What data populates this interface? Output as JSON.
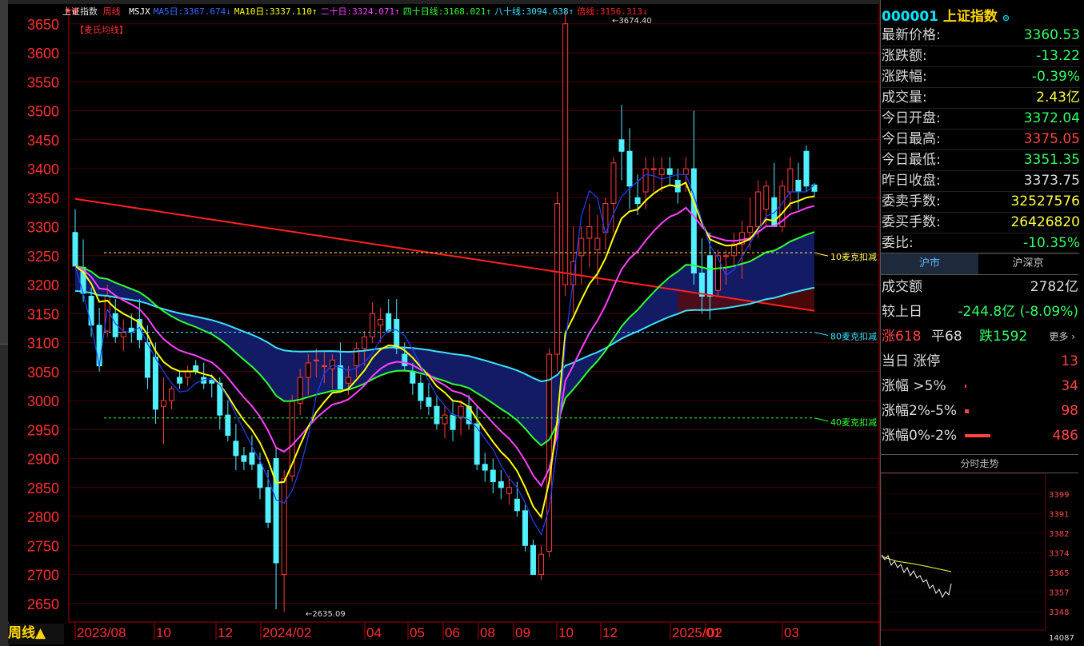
{
  "header": {
    "stock_name": "上证指数",
    "period": "周线",
    "ma_series": [
      {
        "label": "MSJX",
        "value": "",
        "color": "#ffffff"
      },
      {
        "label": "MA5日:",
        "value": "3367.674",
        "arrow": "↓",
        "color": "#3a6bff"
      },
      {
        "label": "MA10日:",
        "value": "3337.110",
        "arrow": "↑",
        "color": "#ffff00"
      },
      {
        "label": "二十日:",
        "value": "3324.071",
        "arrow": "↑",
        "color": "#ff40ff"
      },
      {
        "label": "四十日线:",
        "value": "3168.021",
        "arrow": "↑",
        "color": "#30ff30"
      },
      {
        "label": "八十线:",
        "value": "3094.638",
        "arrow": "↑",
        "color": "#40e0ff"
      },
      {
        "label": "倍线:",
        "value": "3156.313",
        "arrow": "↓",
        "color": "#ff2020"
      }
    ],
    "indicator_label": "【麦氏均线】"
  },
  "chart_data": {
    "type": "candlestick",
    "y_ticks": [
      2650,
      2700,
      2750,
      2800,
      2850,
      2900,
      2950,
      3000,
      3050,
      3100,
      3150,
      3200,
      3250,
      3300,
      3350,
      3400,
      3450,
      3500,
      3550,
      3600,
      3650
    ],
    "ylim": [
      2618,
      3680
    ],
    "x_ticks": [
      "2023/08",
      "10",
      "12",
      "2024/02",
      "04",
      "05",
      "06",
      "08",
      "09",
      "10",
      "12",
      "2025/01",
      "02",
      "03"
    ],
    "high_label": "3674.40",
    "low_label": "2635.09",
    "candles": [
      [
        3290,
        3330,
        3230,
        3232
      ],
      [
        3230,
        3278,
        3170,
        3185
      ],
      [
        3180,
        3195,
        3110,
        3130
      ],
      [
        3130,
        3160,
        3050,
        3060
      ],
      [
        3120,
        3200,
        3110,
        3180
      ],
      [
        3150,
        3175,
        3100,
        3110
      ],
      [
        3110,
        3140,
        3085,
        3118
      ],
      [
        3125,
        3150,
        3100,
        3118
      ],
      [
        3140,
        3175,
        3090,
        3105
      ],
      [
        3100,
        3130,
        3020,
        3040
      ],
      [
        3075,
        3100,
        2960,
        2985
      ],
      [
        2990,
        3040,
        2925,
        3000
      ],
      [
        3000,
        3025,
        2985,
        3020
      ],
      [
        3040,
        3050,
        3020,
        3030
      ],
      [
        3040,
        3060,
        3025,
        3050
      ],
      [
        3060,
        3070,
        3045,
        3050
      ],
      [
        3040,
        3065,
        3020,
        3030
      ],
      [
        3035,
        3045,
        3005,
        3030
      ],
      [
        3030,
        3040,
        2950,
        2975
      ],
      [
        2975,
        3000,
        2930,
        2940
      ],
      [
        2930,
        2960,
        2880,
        2905
      ],
      [
        2905,
        2920,
        2880,
        2895
      ],
      [
        2910,
        2940,
        2880,
        2890
      ],
      [
        2890,
        2910,
        2830,
        2850
      ],
      [
        2850,
        2880,
        2780,
        2790
      ],
      [
        2900,
        2920,
        2640,
        2720
      ],
      [
        2700,
        2880,
        2635,
        2865
      ],
      [
        2870,
        3010,
        2860,
        3000
      ],
      [
        2995,
        3055,
        2975,
        3040
      ],
      [
        3040,
        3080,
        3010,
        3065
      ],
      [
        3070,
        3090,
        3040,
        3070
      ],
      [
        3060,
        3085,
        3030,
        3060
      ],
      [
        3055,
        3080,
        3020,
        3070
      ],
      [
        3060,
        3100,
        3030,
        3020
      ],
      [
        3030,
        3060,
        3010,
        3040
      ],
      [
        3060,
        3100,
        3040,
        3090
      ],
      [
        3090,
        3120,
        3060,
        3110
      ],
      [
        3110,
        3170,
        3100,
        3150
      ],
      [
        3130,
        3160,
        3100,
        3140
      ],
      [
        3150,
        3175,
        3140,
        3120
      ],
      [
        3140,
        3175,
        3080,
        3090
      ],
      [
        3080,
        3100,
        3050,
        3060
      ],
      [
        3050,
        3065,
        3010,
        3030
      ],
      [
        3030,
        3045,
        2985,
        3000
      ],
      [
        3005,
        3030,
        2975,
        2990
      ],
      [
        2990,
        3010,
        2950,
        2960
      ],
      [
        2960,
        2990,
        2935,
        2975
      ],
      [
        2975,
        3000,
        2930,
        2950
      ],
      [
        2970,
        3000,
        2940,
        2990
      ],
      [
        2990,
        3010,
        2950,
        2960
      ],
      [
        2960,
        2990,
        2880,
        2890
      ],
      [
        2890,
        2910,
        2860,
        2880
      ],
      [
        2880,
        2900,
        2840,
        2860
      ],
      [
        2860,
        2880,
        2830,
        2850
      ],
      [
        2840,
        2870,
        2820,
        2850
      ],
      [
        2830,
        2860,
        2800,
        2810
      ],
      [
        2810,
        2820,
        2740,
        2750
      ],
      [
        2750,
        2760,
        2700,
        2700
      ],
      [
        2700,
        2750,
        2690,
        2735
      ],
      [
        2740,
        3090,
        2730,
        3080
      ],
      [
        3080,
        3360,
        3050,
        3340
      ],
      [
        3200,
        3674,
        3180,
        3650
      ],
      [
        3200,
        3300,
        3150,
        3240
      ],
      [
        3250,
        3300,
        3200,
        3280
      ],
      [
        3280,
        3340,
        3230,
        3300
      ],
      [
        3260,
        3320,
        3200,
        3280
      ],
      [
        3290,
        3350,
        3260,
        3340
      ],
      [
        3340,
        3420,
        3290,
        3410
      ],
      [
        3450,
        3510,
        3380,
        3430
      ],
      [
        3430,
        3470,
        3330,
        3370
      ],
      [
        3350,
        3390,
        3320,
        3340
      ],
      [
        3360,
        3420,
        3330,
        3400
      ],
      [
        3400,
        3420,
        3360,
        3400
      ],
      [
        3390,
        3420,
        3360,
        3400
      ],
      [
        3400,
        3420,
        3370,
        3390
      ],
      [
        3380,
        3400,
        3340,
        3360
      ],
      [
        3390,
        3420,
        3360,
        3400
      ],
      [
        3400,
        3500,
        3200,
        3220
      ],
      [
        3220,
        3280,
        3150,
        3180
      ],
      [
        3250,
        3290,
        3140,
        3180
      ],
      [
        3190,
        3260,
        3180,
        3250
      ],
      [
        3250,
        3260,
        3200,
        3250
      ],
      [
        3250,
        3290,
        3230,
        3270
      ],
      [
        3270,
        3310,
        3210,
        3290
      ],
      [
        3290,
        3350,
        3260,
        3300
      ],
      [
        3300,
        3380,
        3280,
        3360
      ],
      [
        3330,
        3380,
        3300,
        3370
      ],
      [
        3350,
        3410,
        3300,
        3300
      ],
      [
        3300,
        3380,
        3290,
        3370
      ],
      [
        3360,
        3420,
        3330,
        3400
      ],
      [
        3380,
        3410,
        3330,
        3360
      ],
      [
        3430,
        3440,
        3360,
        3370
      ],
      [
        3372,
        3375,
        3351,
        3361
      ]
    ],
    "annotations": [
      {
        "text": "10麦克扣减",
        "value": 3255,
        "color": "#ffff60"
      },
      {
        "text": "80麦克扣减",
        "value": 3118,
        "color": "#40e0ff"
      },
      {
        "text": "40麦克扣减",
        "value": 2970,
        "color": "#30ff30"
      }
    ]
  },
  "quote": {
    "code": "000001",
    "name": "上证指数",
    "rows": [
      {
        "label": "最新价格:",
        "value": "3360.53",
        "color": "#33ff66"
      },
      {
        "label": "涨跌额:",
        "value": "-13.22",
        "color": "#33ff66"
      },
      {
        "label": "涨跌幅:",
        "value": "-0.39%",
        "color": "#33ff66"
      },
      {
        "label": "成交量:",
        "value": "2.43亿",
        "color": "#ffff40"
      },
      {
        "label": "今日开盘:",
        "value": "3372.04",
        "color": "#33ff66"
      },
      {
        "label": "今日最高:",
        "value": "3375.05",
        "color": "#ff4444"
      },
      {
        "label": "今日最低:",
        "value": "3351.35",
        "color": "#33ff66"
      },
      {
        "label": "昨日收盘:",
        "value": "3373.75",
        "color": "#dddddd"
      },
      {
        "label": "委卖手数:",
        "value": "32527576",
        "color": "#ffff40"
      },
      {
        "label": "委买手数:",
        "value": "26426820",
        "color": "#ffff40"
      },
      {
        "label": "委比:",
        "value": "-10.35%",
        "color": "#33ff66"
      }
    ]
  },
  "market_tabs": [
    "沪市",
    "沪深京"
  ],
  "market": {
    "turnover_label": "成交额",
    "turnover_value": "2782亿",
    "compare_label": "较上日",
    "compare_value": "-244.8亿 (-8.09%)",
    "up_label": "涨618",
    "flat_label": "平68",
    "down_label": "跌1592",
    "more_label": "更多 ›",
    "limit_label": "当日 涨停",
    "limit_value": "13",
    "gt5_label": "涨幅 >5%",
    "gt5_value": "34",
    "r25_label": "涨幅2%-5%",
    "r25_value": "98",
    "r02_label": "涨幅0%-2%",
    "r02_value": "486"
  },
  "intraday": {
    "title": "分时走势",
    "y_ticks": [
      "3399",
      "3391",
      "3382",
      "3374",
      "3365",
      "3357",
      "3348"
    ],
    "volume_label": "14087"
  }
}
